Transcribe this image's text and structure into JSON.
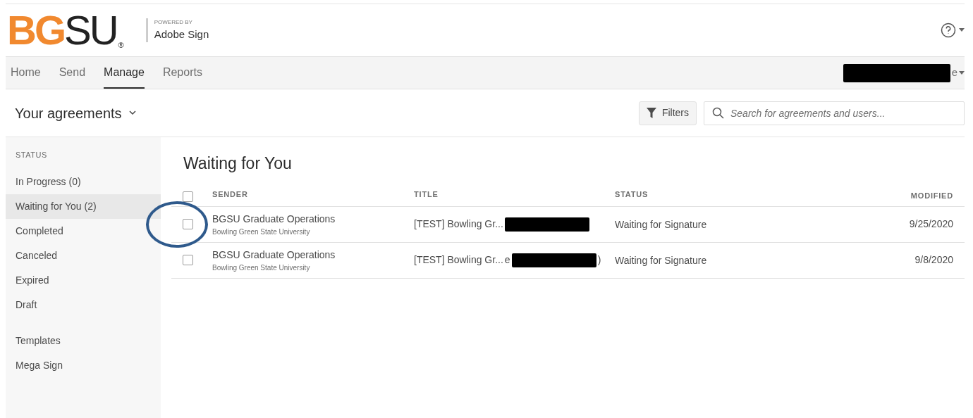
{
  "logo": {
    "orange": "BG",
    "dark": "SU",
    "mark": "®"
  },
  "powered_by": {
    "caption": "POWERED BY",
    "product": "Adobe Sign"
  },
  "nav": {
    "tabs": [
      {
        "label": "Home",
        "selected": false
      },
      {
        "label": "Send",
        "selected": false
      },
      {
        "label": "Manage",
        "selected": true
      },
      {
        "label": "Reports",
        "selected": false
      }
    ],
    "user_menu": "e"
  },
  "page_title": "Your agreements",
  "filters_button": "Filters",
  "search": {
    "placeholder": "Search for agreements and users..."
  },
  "sidebar": {
    "heading": "STATUS",
    "items": [
      {
        "label": "In Progress (0)",
        "selected": false
      },
      {
        "label": "Waiting for You (2)",
        "selected": true
      },
      {
        "label": "Completed",
        "selected": false
      },
      {
        "label": "Canceled",
        "selected": false
      },
      {
        "label": "Expired",
        "selected": false
      },
      {
        "label": "Draft",
        "selected": false
      }
    ],
    "extra_items": [
      {
        "label": "Templates",
        "selected": false
      },
      {
        "label": "Mega Sign",
        "selected": false
      }
    ]
  },
  "section_title": "Waiting for You",
  "table": {
    "select_all_checked": false,
    "columns": [
      "SENDER",
      "TITLE",
      "STATUS",
      "MODIFIED"
    ],
    "rows": [
      {
        "checked": false,
        "circled": true,
        "sender": "BGSU Graduate Operations",
        "organization": "Bowling Green State University",
        "title": "[TEST] Bowling Gr...",
        "title_before": "",
        "title_after": "",
        "status": "Waiting for Signature",
        "modified": "9/25/2020"
      },
      {
        "checked": false,
        "circled": false,
        "sender": "BGSU Graduate Operations",
        "organization": "Bowling Green State University",
        "title": "[TEST] Bowling Gr...",
        "title_before": "e",
        "title_after": ")",
        "status": "Waiting for Signature",
        "modified": "9/8/2020"
      }
    ]
  }
}
